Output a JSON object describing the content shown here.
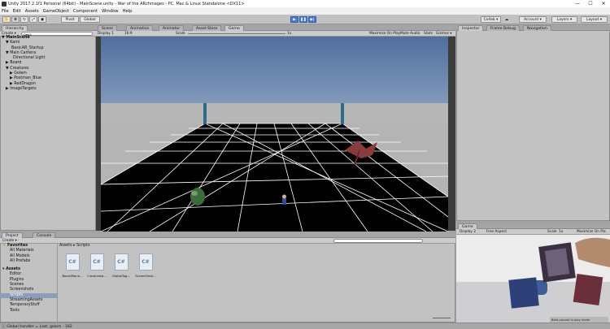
{
  "window": {
    "title": "Unity 2017.2.1f1 Personal (64bit) - MainScene.unity - War of the ARchmages - PC, Mac & Linux Standalone <DX11>",
    "min": "—",
    "max": "☐",
    "close": "✕"
  },
  "menu": [
    "File",
    "Edit",
    "Assets",
    "GameObject",
    "Component",
    "Window",
    "Help"
  ],
  "toolbar": {
    "pivot": "Pivot",
    "global": "Global",
    "collab": "Collab ▾",
    "account": "Account ▾",
    "layers": "Layers ▾",
    "layout": "Layout ▾",
    "hand_icon": "hand-icon",
    "move_icon": "move-icon",
    "rotate_icon": "rotate-icon",
    "scale_icon": "scale-icon",
    "rect_icon": "rect-icon",
    "cloud_icon": "cloud-icon",
    "play_icon": "play-icon",
    "pause_icon": "pause-icon",
    "step_icon": "step-icon",
    "play_state": "active"
  },
  "hierarchy": {
    "tab": "Hierarchy",
    "create": "Create ▾",
    "search_placeholder": "Q▾All",
    "items": [
      {
        "label": "MainScene",
        "arrow": "▼",
        "bold": true
      },
      {
        "label": "▼ Kami",
        "arrow": ""
      },
      {
        "label": "BasicAR_Startup",
        "arrow": ""
      },
      {
        "label": "▼ Main Camera",
        "arrow": ""
      },
      {
        "label": "Directional Light",
        "arrow": ""
      },
      {
        "label": "▶ Board",
        "arrow": ""
      },
      {
        "label": "▼ Creatures",
        "arrow": ""
      },
      {
        "label": "▶ Golem",
        "arrow": ""
      },
      {
        "label": "▶ Postman_Blue",
        "arrow": ""
      },
      {
        "label": "▶ RedDragon",
        "arrow": ""
      },
      {
        "label": "▶ ImageTargets",
        "arrow": ""
      }
    ]
  },
  "center_tabs": [
    "Scene",
    "Animation",
    "Animator",
    "Asset Store",
    "Game"
  ],
  "game_bar": {
    "display": "Display 1",
    "aspect": "16:9",
    "scale_label": "Scale",
    "scale_value": "1x",
    "max_on_play": "Maximize On Play",
    "mute": "Mute Audio",
    "stats": "Stats",
    "gizmos": "Gizmos ▾"
  },
  "inspector_tabs": [
    "Inspector",
    "Frame Debug",
    "Navigation"
  ],
  "small_game": {
    "tab": "Game",
    "display": "Display 2",
    "aspect": "Free Aspect",
    "scale_label": "Scale",
    "scale_value": "1x",
    "max_on_play": "Maximize On Pla",
    "badge": "Beta paused in play mode"
  },
  "project": {
    "tabs": [
      "Project",
      "Console"
    ],
    "create": "Create ▾",
    "favorites": [
      "Favorites",
      "All Materials",
      "All Models",
      "All Prefabs"
    ],
    "assets": [
      "Assets",
      "Editor",
      "Plugins",
      "Scenes",
      "Screenshots",
      "Scripts",
      "StreamingAssets",
      "TemporaryStuff",
      "Tools"
    ],
    "breadcrumb": "Assets ▸ Scripts",
    "files": [
      "BoardMana...",
      "Creatureta...",
      "GlobalTog...",
      "ScreenShot..."
    ],
    "file_glyph": "C#"
  },
  "status": {
    "message": "Global handler = Last: golem - 182"
  },
  "colors": {
    "accent": "#4a7fd0",
    "selection": "#8a9fbd",
    "grid": "#ffffff",
    "scene_bg": "#000000"
  }
}
